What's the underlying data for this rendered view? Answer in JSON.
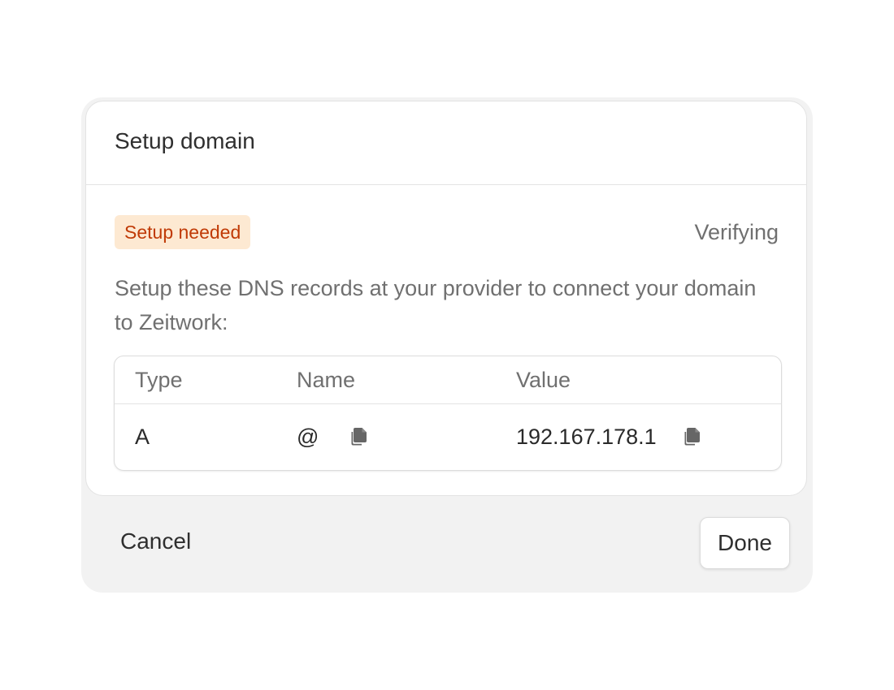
{
  "dialog": {
    "title": "Setup domain",
    "badge": "Setup needed",
    "status": "Verifying",
    "description": "Setup these DNS records at your provider to connect your domain to Zeitwork:"
  },
  "records_table": {
    "columns": [
      "Type",
      "Name",
      "Value"
    ],
    "rows": [
      {
        "type": "A",
        "name": "@",
        "value": "192.167.178.1"
      }
    ]
  },
  "footer": {
    "cancel_label": "Cancel",
    "done_label": "Done"
  },
  "icons": {
    "copy": "copy-icon"
  },
  "colors": {
    "badge_bg": "#fde9d2",
    "badge_text": "#c03a06",
    "muted_text": "#707070"
  }
}
